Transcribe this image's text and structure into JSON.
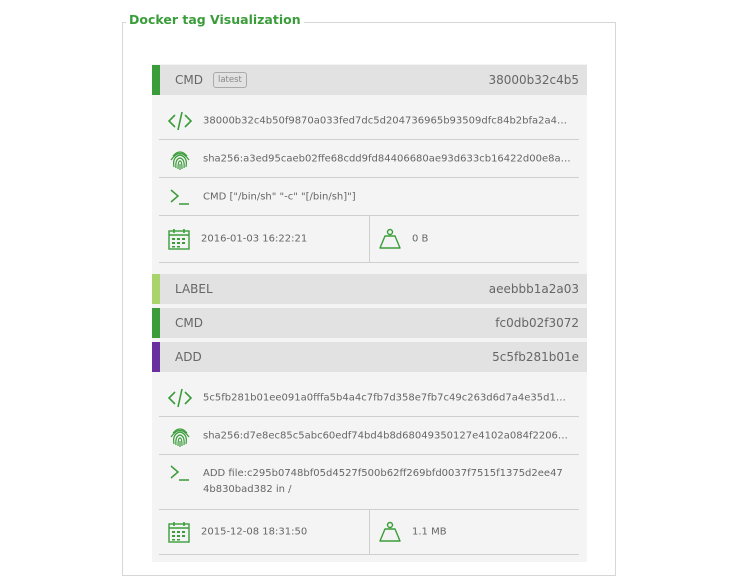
{
  "panel": {
    "title": "Docker tag Visualization"
  },
  "layers": [
    {
      "name": "CMD",
      "tag": "latest",
      "hash": "38000b32c4b5",
      "color": "#3a9d3a",
      "details": {
        "id": "38000b32c4b50f9870a033fed7dc5d204736965b93509dfc84b2bfa2a441e...",
        "digest": "sha256:a3ed95caeb02ffe68cdd9fd84406680ae93d633cb16422d00e8a7c...",
        "command": "CMD [\"/bin/sh\" \"-c\" \"[/bin/sh]\"]",
        "created": "2016-01-03 16:22:21",
        "size": "0 B"
      }
    },
    {
      "name": "LABEL",
      "hash": "aeebbb1a2a03",
      "color": "#a9d46b"
    },
    {
      "name": "CMD",
      "hash": "fc0db02f3072",
      "color": "#3a9d3a"
    },
    {
      "name": "ADD",
      "hash": "5c5fb281b01e",
      "color": "#6a2f9e",
      "details": {
        "id": "5c5fb281b01ee091a0fffa5b4a4c7fb7d358e7fb7c49c263d6d7a4e35d199f...",
        "digest": "sha256:d7e8ec85c5abc60edf74bd4b8d68049350127e4102a084f22060f7...",
        "command": "ADD file:c295b0748bf05d4527f500b62ff269bfd0037f7515f1375d2ee474b830bad382 in /",
        "created": "2015-12-08 18:31:50",
        "size": "1.1 MB"
      }
    }
  ],
  "icons": {
    "id": "code-icon",
    "digest": "fingerprint-icon",
    "command": "terminal-icon",
    "created": "calendar-icon",
    "size": "weight-icon"
  },
  "accent": "#3a9d3a"
}
